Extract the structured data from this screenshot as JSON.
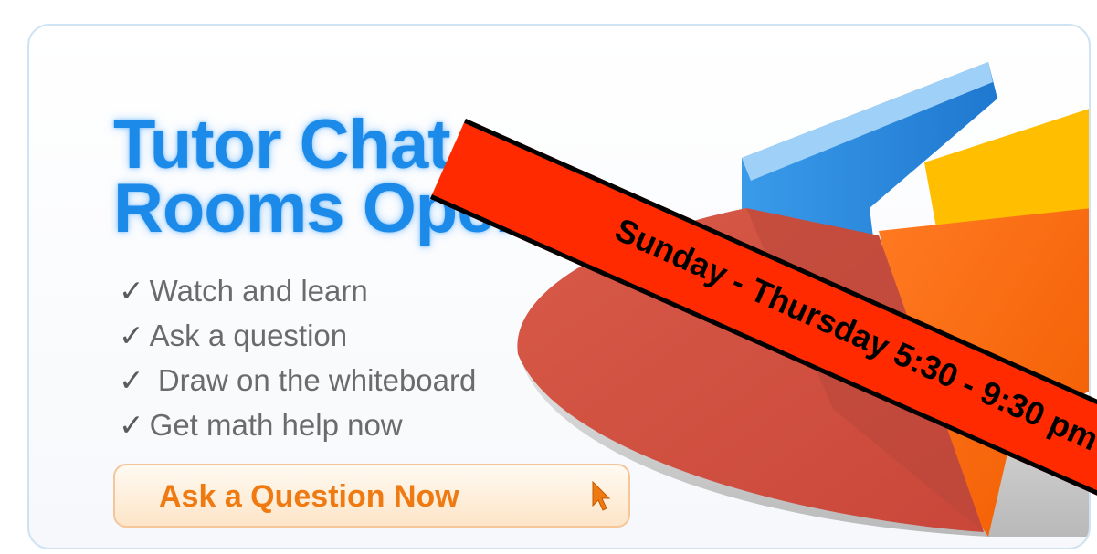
{
  "banner": {
    "title_line1": "Tutor Chat",
    "title_line2": "Rooms Open!",
    "features": [
      "Watch and learn",
      "Ask a question",
      " Draw on the whiteboard",
      "Get math help now"
    ],
    "check_glyph": "✓",
    "cta_label": "Ask a Question Now",
    "cursor_icon": "pointer-arrow-icon",
    "illustration_icon": "pie-chart-illustration"
  },
  "ribbon": {
    "text": "Sunday - Thursday 5:30 - 9:30 pm"
  },
  "colors": {
    "title": "#1c8ae8",
    "feature_text": "#6b6b6b",
    "cta_text": "#f07a12",
    "ribbon_fill": "#ff2a00",
    "pie_red": "#d5503f",
    "pie_blue": "#2f8fe0",
    "pie_orange": "#ff6a10",
    "pie_yellow": "#ffc000"
  }
}
